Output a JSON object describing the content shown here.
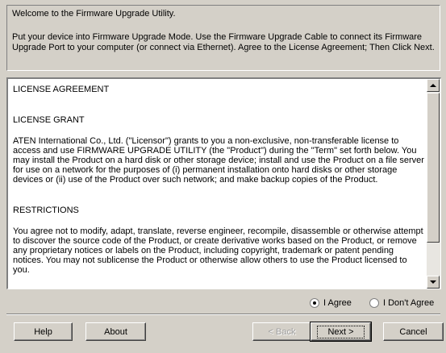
{
  "header": {
    "welcome": "Welcome to the Firmware Upgrade Utility.",
    "instruction": "Put your device into Firmware Upgrade Mode. Use the Firmware Upgrade Cable to connect its Firmware Upgrade Port to your computer (or connect via Ethernet). Agree to the License Agreement; Then Click Next."
  },
  "license": {
    "title": "LICENSE AGREEMENT",
    "grant_heading": "LICENSE GRANT",
    "grant_text": "ATEN International Co., Ltd. (\"Licensor\") grants to you a non-exclusive, non-transferable license to access and use FIRMWARE UPGRADE UTILITY (the \"Product\") during the \"Term\" set forth below. You may install the Product on a hard disk or other storage device; install and use the Product on a file server for use on a network for the purposes of (i) permanent installation onto hard disks or other storage devices or (ii) use of the Product over such network; and make backup copies of the Product.",
    "restrictions_heading": "RESTRICTIONS",
    "restrictions_text": "You agree not to modify, adapt, translate, reverse engineer, recompile, disassemble or otherwise attempt to discover the source code of the Product, or create derivative works based on the Product, or remove any proprietary notices or labels on the Product, including copyright, trademark or patent pending notices. You may not sublicense the Product or otherwise allow others to use the Product licensed to you."
  },
  "agreement": {
    "agree_label": "I Agree",
    "disagree_label": "I Don't Agree",
    "selected": "agree"
  },
  "buttons": {
    "help": "Help",
    "about": "About",
    "back": "< Back",
    "next": "Next >",
    "cancel": "Cancel"
  }
}
